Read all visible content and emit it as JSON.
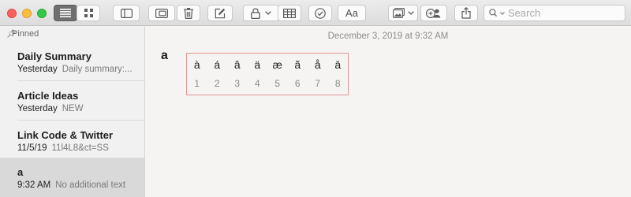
{
  "toolbar": {
    "search_placeholder": "Search",
    "font_button_label": "Aa",
    "buttons": [
      "list-view",
      "gallery-view",
      "toggle-sidebar",
      "attachments",
      "delete",
      "compose",
      "lock",
      "table",
      "checklist",
      "format",
      "media",
      "collaborate",
      "share"
    ]
  },
  "sidebar": {
    "section_label": "Pinned",
    "notes": [
      {
        "title": "Daily Summary",
        "date": "Yesterday",
        "preview": "Daily summary:..."
      },
      {
        "title": "Article Ideas",
        "date": "Yesterday",
        "preview": "NEW"
      },
      {
        "title": "Link Code & Twitter",
        "date": "11/5/19",
        "preview": "11l4L8&ct=SS"
      },
      {
        "title": "a",
        "date": "9:32 AM",
        "preview": "No additional text"
      }
    ]
  },
  "editor": {
    "date": "December 3, 2019 at 9:32 AM",
    "heading": "a",
    "table": {
      "row1": [
        "à",
        "á",
        "â",
        "ä",
        "æ",
        "ã",
        "å",
        "ā"
      ],
      "row2": [
        "1",
        "2",
        "3",
        "4",
        "5",
        "6",
        "7",
        "8"
      ]
    }
  },
  "colors": {
    "table_border": "#e09595",
    "selected_note": "#d9d9d9"
  }
}
